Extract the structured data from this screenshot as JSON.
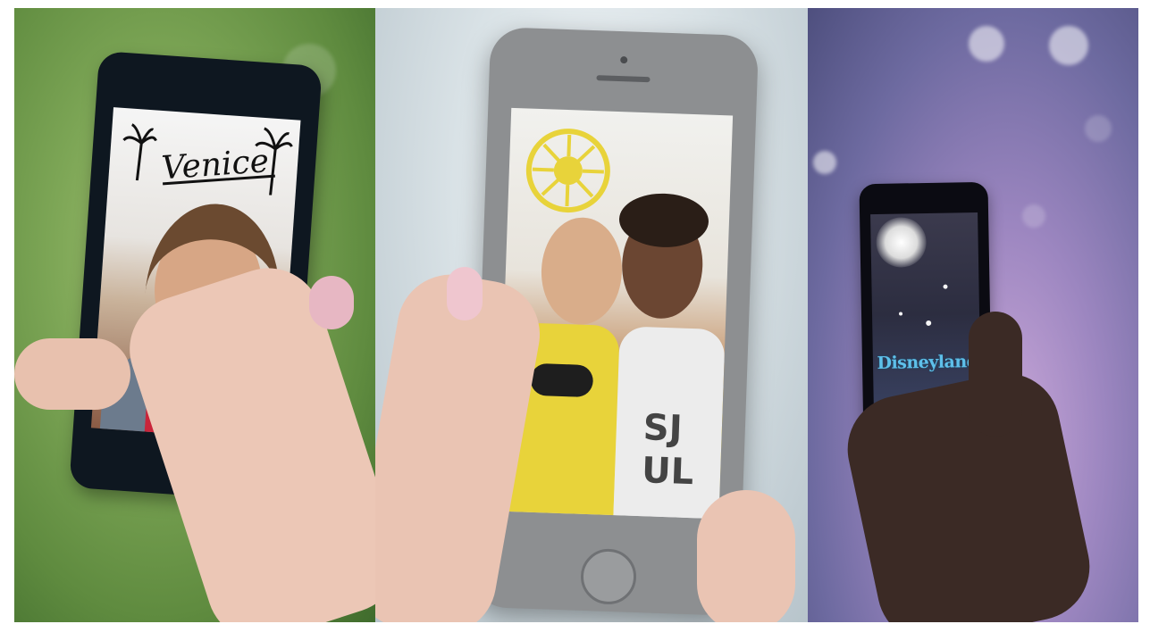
{
  "panels": [
    {
      "id": "panel-1",
      "scene": "venice",
      "filter_text": "Venice",
      "accent": "#7da656"
    },
    {
      "id": "panel-2",
      "scene": "sun-filter",
      "shirt_text_top": "SJ",
      "shirt_text_bottom": "UL",
      "accent": "#e8d33a"
    },
    {
      "id": "panel-3",
      "scene": "disneyland",
      "filter_text": "Disneyland",
      "accent": "#5ec0ea"
    }
  ],
  "colors": {
    "venice_green": "#7da656",
    "sun_yellow": "#e8d33a",
    "disney_blue": "#5ec0ea",
    "phone_dark": "#0e1720"
  }
}
